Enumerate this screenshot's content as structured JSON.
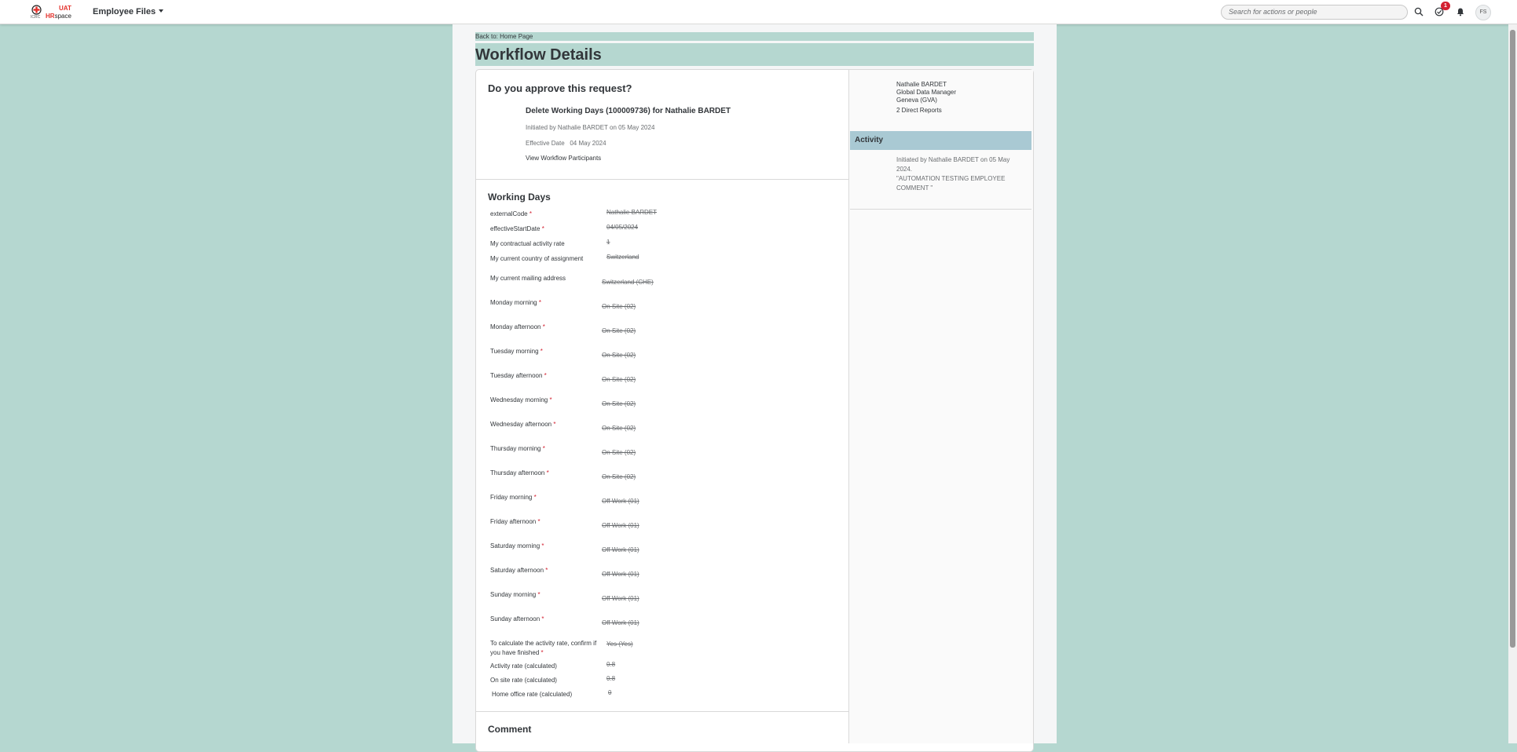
{
  "shell": {
    "logo_uat": "UAT",
    "logo_hr": "HR",
    "logo_space": "space",
    "logo_sub": "ICRC",
    "menu_label": "Employee Files",
    "search_placeholder": "Search for actions or people",
    "notification_count": "1",
    "avatar_initials": "FS",
    "icons": [
      "search-icon",
      "tasks-icon",
      "bell-icon"
    ]
  },
  "page": {
    "back_link": "Back to: Home Page",
    "title": "Workflow Details"
  },
  "request": {
    "question": "Do you approve this request?",
    "title": "Delete Working Days (100009736) for Nathalie BARDET",
    "initiated": "Initiated by Nathalie BARDET on 05 May 2024",
    "effective_label": "Effective Date",
    "effective_date": "04 May 2024",
    "participants_link": "View Workflow Participants"
  },
  "working_days": {
    "heading": "Working Days",
    "fields": [
      {
        "label": "externalCode",
        "required": "*",
        "value": "Nathalie BARDET"
      },
      {
        "label": "effectiveStartDate",
        "required": "*",
        "value": "04/05/2024"
      },
      {
        "label": "My contractual activity rate",
        "required": "",
        "value": "1"
      },
      {
        "label": "My current country of assignment",
        "required": "",
        "value": "Switzerland"
      },
      {
        "label": "My current mailing address",
        "required": "",
        "value": "Switzerland (CHE)"
      },
      {
        "label": "Monday morning",
        "required": "*",
        "value": "On Site (02)"
      },
      {
        "label": "Monday afternoon",
        "required": "*",
        "value": "On Site (02)"
      },
      {
        "label": "Tuesday morning",
        "required": "*",
        "value": "On Site (02)"
      },
      {
        "label": "Tuesday afternoon",
        "required": "*",
        "value": "On Site (02)"
      },
      {
        "label": "Wednesday morning",
        "required": "*",
        "value": "On Site (02)"
      },
      {
        "label": "Wednesday afternoon",
        "required": "*",
        "value": "On Site (02)"
      },
      {
        "label": "Thursday morning",
        "required": "*",
        "value": "On Site (02)"
      },
      {
        "label": "Thursday afternoon",
        "required": "*",
        "value": "On Site (02)"
      },
      {
        "label": "Friday morning",
        "required": "*",
        "value": "Off Work (01)"
      },
      {
        "label": "Friday afternoon",
        "required": "*",
        "value": "Off Work (01)"
      },
      {
        "label": "Saturday morning",
        "required": "*",
        "value": "Off Work (01)"
      },
      {
        "label": "Saturday afternoon",
        "required": "*",
        "value": "Off Work (01)"
      },
      {
        "label": "Sunday morning",
        "required": "*",
        "value": "Off Work (01)"
      },
      {
        "label": "Sunday afternoon",
        "required": "*",
        "value": "Off Work (01)"
      },
      {
        "label": "To calculate the activity rate, confirm if you have finished",
        "required": "*",
        "value": "Yes (Yes)"
      },
      {
        "label": "Activity rate (calculated)",
        "required": "",
        "value": "0.8"
      },
      {
        "label": "On site rate (calculated)",
        "required": "",
        "value": "0.8"
      },
      {
        "label": "Home office rate (calculated)",
        "required": "",
        "value": "0"
      }
    ]
  },
  "comment": {
    "heading": "Comment"
  },
  "person": {
    "name": "Nathalie BARDET",
    "role": "Global Data Manager",
    "location": "Geneva (GVA)",
    "reports": "2 Direct Reports"
  },
  "activity": {
    "heading": "Activity",
    "text": "Initiated by Nathalie BARDET on 05 May 2024.",
    "comment": "\"AUTOMATION TESTING EMPLOYEE COMMENT \""
  },
  "colors": {
    "background": "#b5d7d0",
    "activity_header": "#a9c9d3",
    "required": "#d32030",
    "badge": "#d32030"
  }
}
